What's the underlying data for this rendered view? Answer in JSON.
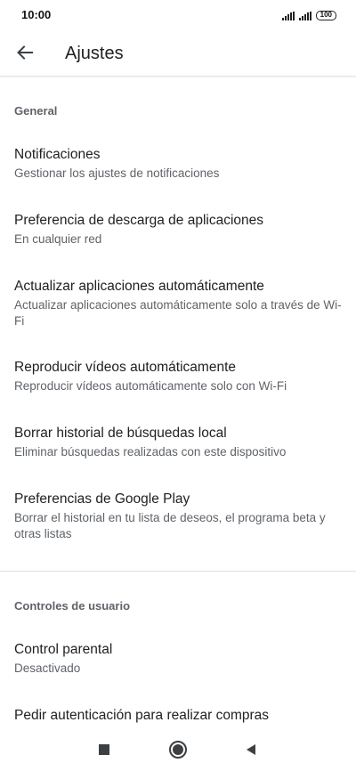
{
  "status_bar": {
    "time": "10:00",
    "battery": "100",
    "icons": [
      "signal-icon",
      "signal-icon",
      "battery-icon"
    ]
  },
  "app_bar": {
    "title": "Ajustes",
    "back_icon": "arrow-back-icon"
  },
  "sections": [
    {
      "header": "General",
      "items": [
        {
          "title": "Notificaciones",
          "subtitle": "Gestionar los ajustes de notificaciones"
        },
        {
          "title": "Preferencia de descarga de aplicaciones",
          "subtitle": "En cualquier red"
        },
        {
          "title": "Actualizar aplicaciones automáticamente",
          "subtitle": "Actualizar aplicaciones automáticamente solo a través de Wi-Fi"
        },
        {
          "title": "Reproducir vídeos automáticamente",
          "subtitle": "Reproducir vídeos automáticamente solo con Wi-Fi"
        },
        {
          "title": "Borrar historial de búsquedas local",
          "subtitle": "Eliminar búsquedas realizadas con este dispositivo"
        },
        {
          "title": "Preferencias de Google Play",
          "subtitle": "Borrar el historial en tu lista de deseos, el programa beta y otras listas"
        }
      ]
    },
    {
      "header": "Controles de usuario",
      "items": [
        {
          "title": "Control parental",
          "subtitle": "Desactivado"
        },
        {
          "title": "Pedir autenticación para realizar compras",
          "subtitle": ""
        }
      ]
    }
  ],
  "nav_bar": {
    "icons": [
      "recents-square-icon",
      "home-circle-icon",
      "back-triangle-icon"
    ]
  },
  "colors": {
    "text_primary": "#202124",
    "text_secondary": "#5f6368",
    "divider": "#e0e0e0",
    "background": "#ffffff"
  }
}
